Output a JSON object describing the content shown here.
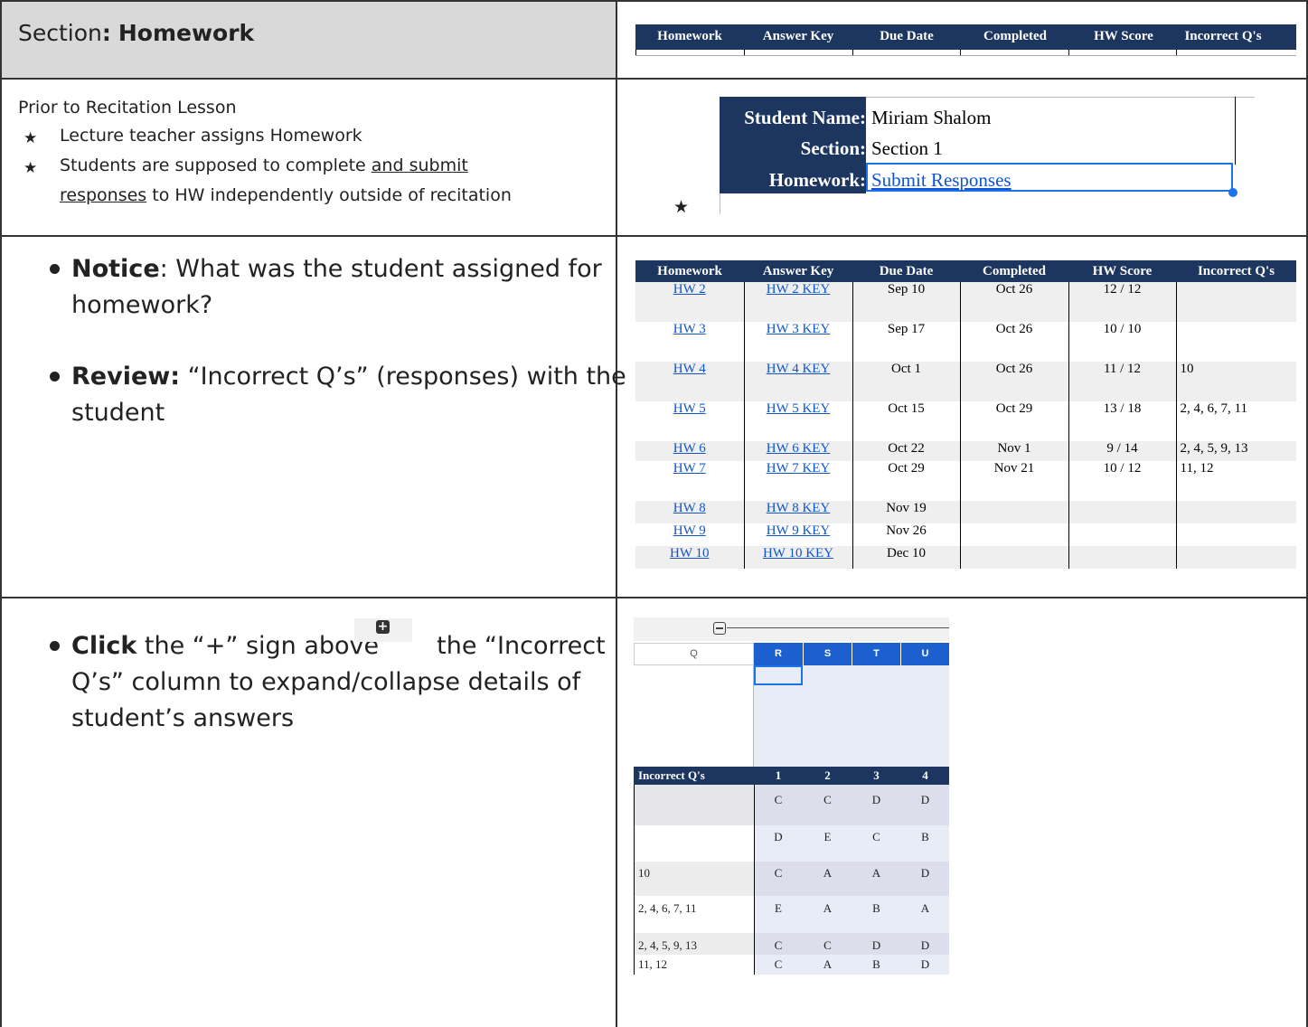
{
  "section": {
    "prefix": "Section",
    "colon": ":",
    "name": "Homework"
  },
  "top_strip": {
    "headers": [
      "Homework",
      "Answer Key",
      "Due Date",
      "Completed",
      "HW Score",
      "Incorrect Q's"
    ]
  },
  "prior": {
    "title": "Prior to Recitation Lesson",
    "bullet1": "Lecture teacher assigns Homework",
    "bullet2_a": "Students are supposed to complete ",
    "bullet2_u1": "and submit",
    "bullet2_u2": "responses",
    "bullet2_b": " to HW independently outside of recitation"
  },
  "student_card": {
    "name_label": "Student Name:",
    "name_value": "Miriam Shalom",
    "section_label": "Section:",
    "section_value": "Section 1",
    "hw_label": "Homework:",
    "hw_link": "Submit Responses",
    "star": "★"
  },
  "notice": {
    "notice_bold": "Notice",
    "notice_rest_1": ": What was the student assigned for",
    "notice_rest_2": "homework?",
    "review_bold": "Review:",
    "review_rest_1": " “Incorrect Q’s” (responses) with the",
    "review_rest_2": "student"
  },
  "hw_table": {
    "headers": [
      "Homework",
      "Answer Key",
      "Due Date",
      "Completed",
      "HW Score",
      "Incorrect Q's"
    ],
    "rows": [
      {
        "hw": "HW 2",
        "key": "HW 2 KEY",
        "due": "Sep 10",
        "completed": "Oct 26",
        "score": "12 / 12",
        "incorrect": ""
      },
      {
        "hw": "HW 3",
        "key": "HW 3 KEY",
        "due": "Sep 17",
        "completed": "Oct 26",
        "score": "10 / 10",
        "incorrect": ""
      },
      {
        "hw": "HW 4",
        "key": "HW 4 KEY",
        "due": "Oct 1",
        "completed": "Oct 26",
        "score": "11 / 12",
        "incorrect": "10"
      },
      {
        "hw": "HW 5",
        "key": "HW 5 KEY",
        "due": "Oct 15",
        "completed": "Oct 29",
        "score": "13 / 18",
        "incorrect": "2, 4, 6, 7, 11"
      },
      {
        "hw": "HW 6",
        "key": "HW 6 KEY",
        "due": "Oct 22",
        "completed": "Nov 1",
        "score": "9 / 14",
        "incorrect": "2, 4, 5, 9, 13"
      },
      {
        "hw": "HW 7",
        "key": "HW 7 KEY",
        "due": "Oct 29",
        "completed": "Nov 21",
        "score": "10 / 12",
        "incorrect": "11, 12"
      },
      {
        "hw": "HW 8",
        "key": "HW 8 KEY",
        "due": "Nov 19",
        "completed": "",
        "score": "",
        "incorrect": ""
      },
      {
        "hw": "HW 9",
        "key": "HW 9 KEY",
        "due": "Nov 26",
        "completed": "",
        "score": "",
        "incorrect": ""
      },
      {
        "hw": "HW 10",
        "key": "HW 10 KEY",
        "due": "Dec 10",
        "completed": "",
        "score": "",
        "incorrect": ""
      }
    ]
  },
  "click": {
    "click_bold": "Click",
    "line1_a": " the “+” sign above",
    "line1_b": "the “Incorrect",
    "line2": "Q’s” column  to expand/collapse details of",
    "line3": "student’s answers",
    "plus_icon": "plus-square-icon"
  },
  "answers_sheet": {
    "collapse_icon": "minus-square-icon",
    "col_letters": [
      "Q",
      "R",
      "S",
      "T",
      "U"
    ],
    "header_label": "Incorrect Q's",
    "header_nums": [
      "1",
      "2",
      "3",
      "4"
    ],
    "rows": [
      {
        "incorrect": "",
        "answers": [
          "C",
          "C",
          "D",
          "D"
        ]
      },
      {
        "incorrect": "",
        "answers": [
          "D",
          "E",
          "C",
          "B"
        ]
      },
      {
        "incorrect": "10",
        "answers": [
          "C",
          "A",
          "A",
          "D"
        ]
      },
      {
        "incorrect": "2, 4, 6, 7, 11",
        "answers": [
          "E",
          "A",
          "B",
          "A"
        ]
      },
      {
        "incorrect": "2, 4, 5, 9, 13",
        "answers": [
          "C",
          "C",
          "D",
          "D"
        ]
      },
      {
        "incorrect": "11, 12",
        "answers": [
          "C",
          "A",
          "B",
          "D"
        ]
      }
    ]
  },
  "colors": {
    "navy": "#1c365f",
    "link": "#1155cc",
    "select": "#1a73e8",
    "lightblue": "#e8ecf7"
  }
}
